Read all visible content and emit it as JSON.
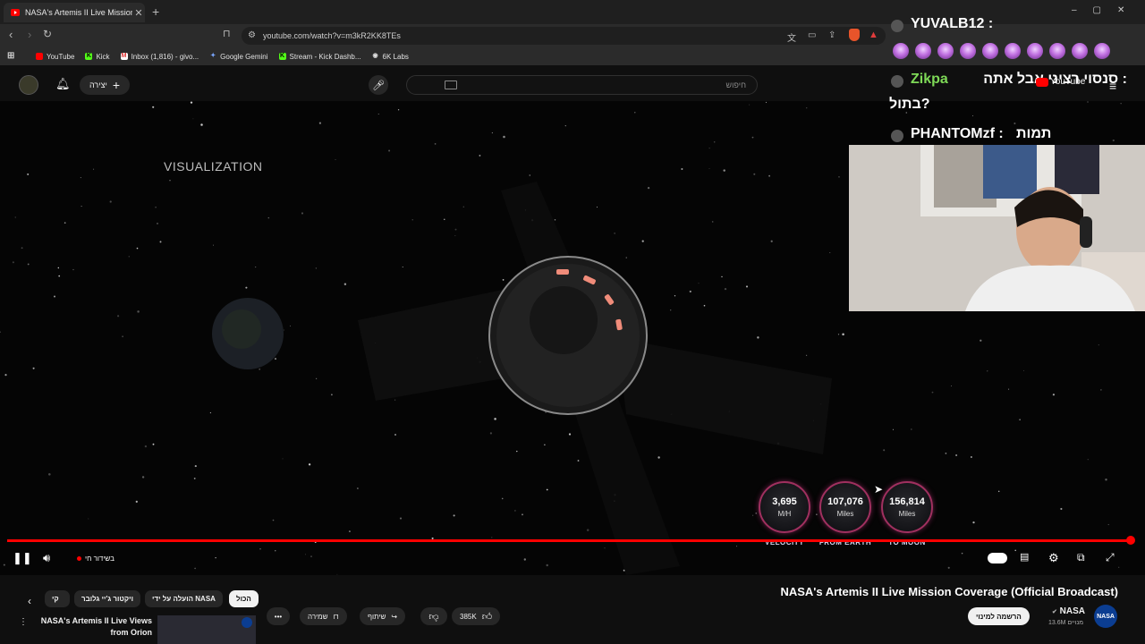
{
  "browser": {
    "tab_title": "NASA's Artemis II Live Mission C",
    "new_tab": "+",
    "url": "youtube.com/watch?v=m3kR2KK8TEs",
    "bookmarks": [
      "YouTube",
      "Kick",
      "Inbox (1,816) - givo...",
      "Google Gemini",
      "Stream - Kick Dashb...",
      "6K Labs"
    ]
  },
  "youtube_header": {
    "create_label": "יצירה",
    "search_placeholder": "חיפוש",
    "logo_text": "YouTube"
  },
  "video": {
    "overlay_label": "VISUALIZATION",
    "gauges": [
      {
        "value": "3,695",
        "unit": "M/H",
        "label": "VELOCITY"
      },
      {
        "value": "107,076",
        "unit": "Miles",
        "label": "FROM EARTH"
      },
      {
        "value": "156,814",
        "unit": "Miles",
        "label": "TO MOON"
      }
    ],
    "live_label": "בשידור חי",
    "progress_fraction": 1.0
  },
  "chat": {
    "lines": [
      {
        "user": "YUVALB12 :",
        "text": ""
      },
      {
        "user": "Zikpa",
        "text": "סנסוי רציני אבל אתה :"
      },
      {
        "user": "",
        "text": "בתול?"
      },
      {
        "user": "PHANTOMzf :",
        "text": "תמות"
      }
    ]
  },
  "below": {
    "title": "NASA's Artemis II Live Mission Coverage (Official Broadcast)",
    "channel": "NASA",
    "subscribers": "13.6M מנויים",
    "subscribe_label": "הרשמה למינוי",
    "likes": "385K",
    "share_label": "שיתוף",
    "save_label": "שמירה",
    "chips": [
      "הכול",
      "הועלה על ידי NASA",
      "ויקטור ג'יי גלובר",
      "קי"
    ],
    "related_title_1": "NASA's Artemis II Live Views",
    "related_title_2": "from Orion"
  },
  "colors": {
    "progress": "#ff0000",
    "gauge_ring": "#a0305f",
    "chat_user_green": "#7ed957"
  }
}
